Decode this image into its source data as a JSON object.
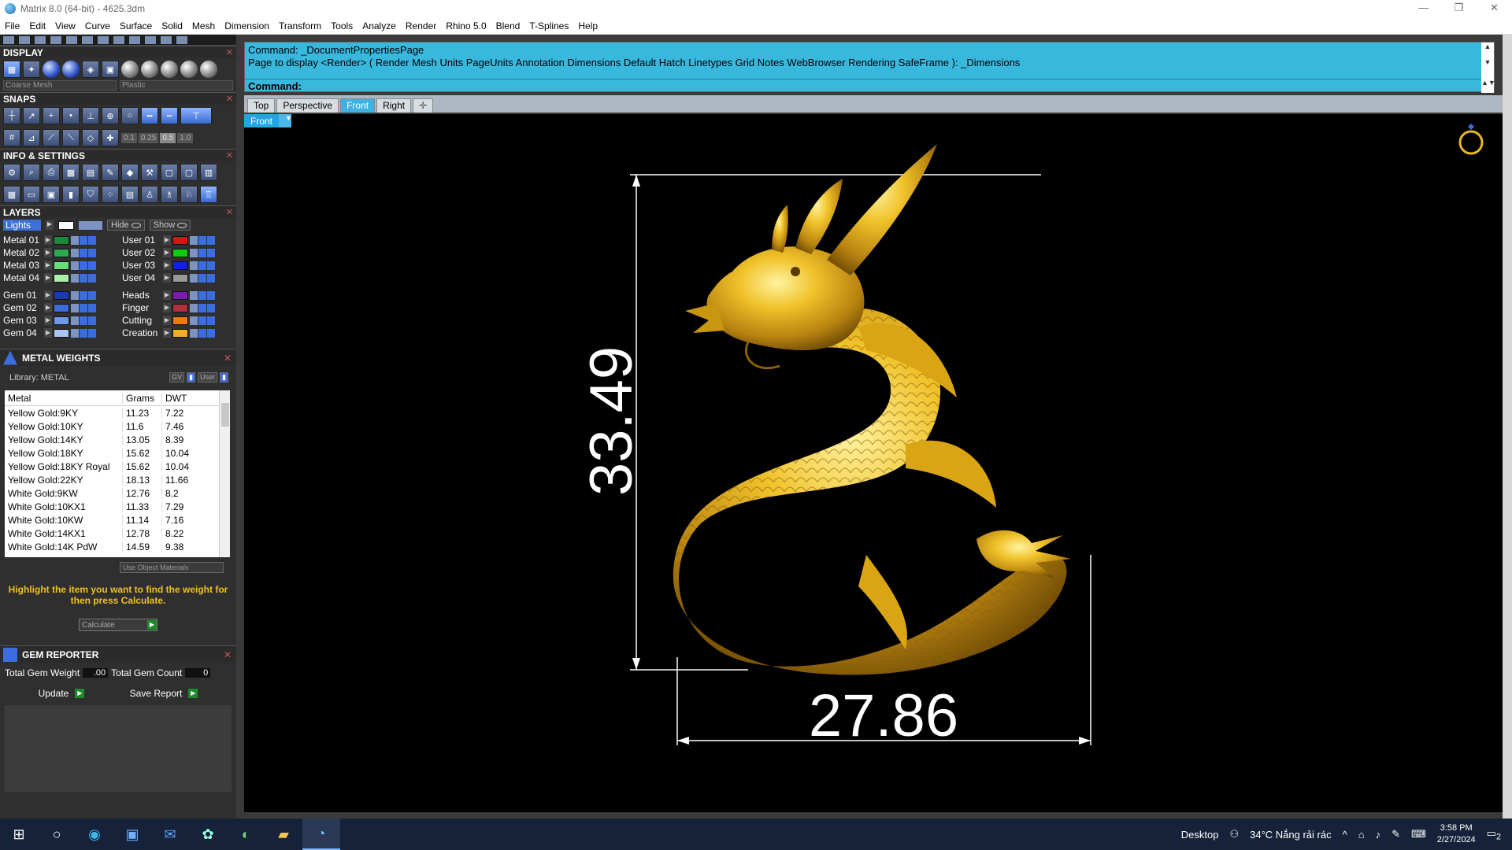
{
  "window": {
    "title": "Matrix 8.0 (64-bit) - 4625.3dm",
    "controls": [
      "—",
      "❐",
      "✕"
    ]
  },
  "menu": [
    "File",
    "Edit",
    "View",
    "Curve",
    "Surface",
    "Solid",
    "Mesh",
    "Dimension",
    "Transform",
    "Tools",
    "Analyze",
    "Render",
    "Rhino 5.0",
    "Blend",
    "T-Splines",
    "Help"
  ],
  "display": {
    "title": "DISPLAY",
    "mesh_select": "Coarse Mesh",
    "material_select": "Plastic"
  },
  "snaps": {
    "title": "SNAPS",
    "values": [
      "0.1",
      "0.25",
      "0.5",
      "1.0"
    ]
  },
  "info": {
    "title": "INFO & SETTINGS"
  },
  "layers": {
    "title": "LAYERS",
    "lights": "Lights",
    "hide": "Hide",
    "show": "Show",
    "left": [
      {
        "name": "Metal 01",
        "color": "#1a8a3a"
      },
      {
        "name": "Metal 02",
        "color": "#2eaa55"
      },
      {
        "name": "Metal 03",
        "color": "#66dd77"
      },
      {
        "name": "Metal 04",
        "color": "#aaeeaa"
      },
      {
        "name": "Gem 01",
        "color": "#1a3bb0"
      },
      {
        "name": "Gem 02",
        "color": "#3b6ddb"
      },
      {
        "name": "Gem 03",
        "color": "#6f98ee"
      },
      {
        "name": "Gem 04",
        "color": "#a8c4f5"
      }
    ],
    "right": [
      {
        "name": "User 01",
        "color": "#dd1111"
      },
      {
        "name": "User 02",
        "color": "#11cc11"
      },
      {
        "name": "User 03",
        "color": "#1122dd"
      },
      {
        "name": "User 04",
        "color": "#999999"
      },
      {
        "name": "Heads",
        "color": "#7a1ab0"
      },
      {
        "name": "Finger",
        "color": "#b03040"
      },
      {
        "name": "Cutting",
        "color": "#ee7711"
      },
      {
        "name": "Creation",
        "color": "#f0b020"
      }
    ]
  },
  "metal_weights": {
    "title": "METAL WEIGHTS",
    "library": "Library: METAL",
    "toggle_gv": "GV",
    "toggle_user": "User",
    "columns": [
      "Metal",
      "Grams",
      "DWT"
    ],
    "rows": [
      [
        "Yellow Gold:9KY",
        "11.23",
        "7.22"
      ],
      [
        "Yellow Gold:10KY",
        "11.6",
        "7.46"
      ],
      [
        "Yellow Gold:14KY",
        "13.05",
        "8.39"
      ],
      [
        "Yellow Gold:18KY",
        "15.62",
        "10.04"
      ],
      [
        "Yellow Gold:18KY Royal",
        "15.62",
        "10.04"
      ],
      [
        "Yellow Gold:22KY",
        "18.13",
        "11.66"
      ],
      [
        "White Gold:9KW",
        "12.76",
        "8.2"
      ],
      [
        "White Gold:10KX1",
        "11.33",
        "7.29"
      ],
      [
        "White Gold:10KW",
        "11.14",
        "7.16"
      ],
      [
        "White Gold:14KX1",
        "12.78",
        "8.22"
      ],
      [
        "White Gold:14K PdW",
        "14.59",
        "9.38"
      ]
    ],
    "use_object_materials": "Use Object Materials",
    "hint": "Highlight the item you want to find the weight for then press Calculate.",
    "calculate": "Calculate"
  },
  "gem_reporter": {
    "title": "GEM REPORTER",
    "total_weight_label": "Total Gem Weight",
    "total_weight_value": ".00",
    "total_count_label": "Total Gem Count",
    "total_count_value": "0",
    "update": "Update",
    "save_report": "Save Report"
  },
  "command": {
    "line1": "Command: _DocumentPropertiesPage",
    "line2": "Page to display <Render> ( Render  Mesh  Units  PageUnits  Annotation  Dimensions  Default  Hatch  Linetypes  Grid  Notes  WebBrowser  Rendering  SafeFrame ): _Dimensions",
    "prompt": "Command:"
  },
  "viewport_tabs": [
    "Top",
    "Perspective",
    "Front",
    "Right"
  ],
  "viewport": {
    "label": "Front",
    "dim_vertical": "33.49",
    "dim_horizontal": "27.86"
  },
  "taskbar": {
    "desktop": "Desktop",
    "weather": "34°C  Nắng rải rác",
    "time": "3:58 PM",
    "date": "2/27/2024",
    "notif": "2"
  },
  "colors": {
    "cmd_bg": "#39b8de",
    "active_tab": "#3fb1e0",
    "gold": "#e8b820",
    "hint": "#f0c020"
  }
}
